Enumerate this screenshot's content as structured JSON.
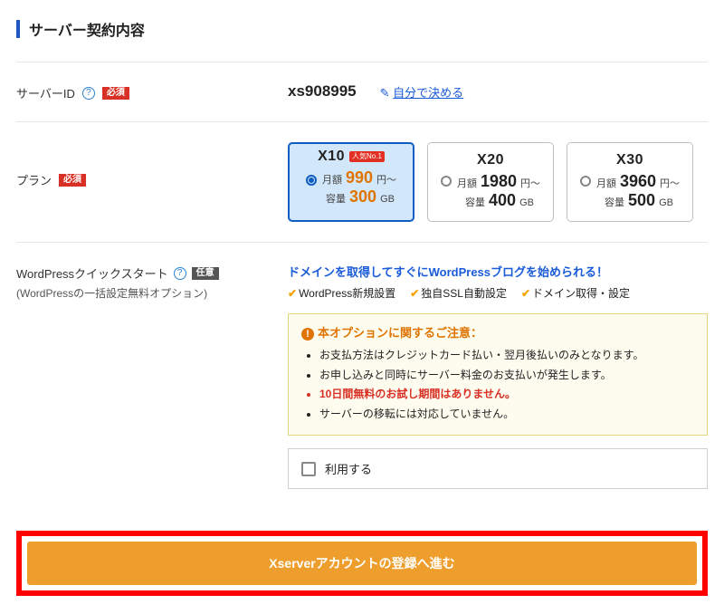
{
  "section_title": "サーバー契約内容",
  "server_id": {
    "label": "サーバーID",
    "required_badge": "必須",
    "value": "xs908995",
    "decide_link": "自分で決める"
  },
  "plan": {
    "label": "プラン",
    "required_badge": "必須",
    "popular_badge": "人気No.1",
    "options": [
      {
        "name": "X10",
        "selected": true,
        "popular": true,
        "monthly_label": "月額",
        "monthly_value": "990",
        "monthly_suffix": "円～",
        "cap_label": "容量",
        "cap_value": "300",
        "cap_suffix": "GB"
      },
      {
        "name": "X20",
        "selected": false,
        "popular": false,
        "monthly_label": "月額",
        "monthly_value": "1980",
        "monthly_suffix": "円～",
        "cap_label": "容量",
        "cap_value": "400",
        "cap_suffix": "GB"
      },
      {
        "name": "X30",
        "selected": false,
        "popular": false,
        "monthly_label": "月額",
        "monthly_value": "3960",
        "monthly_suffix": "円～",
        "cap_label": "容量",
        "cap_value": "500",
        "cap_suffix": "GB"
      }
    ]
  },
  "quickstart": {
    "label": "WordPressクイックスタート",
    "optional_badge": "任意",
    "sub_label": "(WordPressの一括設定無料オプション)",
    "headline": "ドメインを取得してすぐにWordPressブログを始められる！",
    "checks": [
      "WordPress新規設置",
      "独自SSL自動設定",
      "ドメイン取得・設定"
    ],
    "note_title": "本オプションに関するご注意：",
    "notes": [
      {
        "text": "お支払方法はクレジットカード払い・翌月後払いのみとなります。",
        "warn": false
      },
      {
        "text": "お申し込みと同時にサーバー料金のお支払いが発生します。",
        "warn": false
      },
      {
        "text": "10日間無料のお試し期間はありません。",
        "warn": true
      },
      {
        "text": "サーバーの移転には対応していません。",
        "warn": false
      }
    ],
    "use_label": "利用する",
    "use_checked": false
  },
  "cta": {
    "label": "Xserverアカウントの登録へ進む"
  }
}
